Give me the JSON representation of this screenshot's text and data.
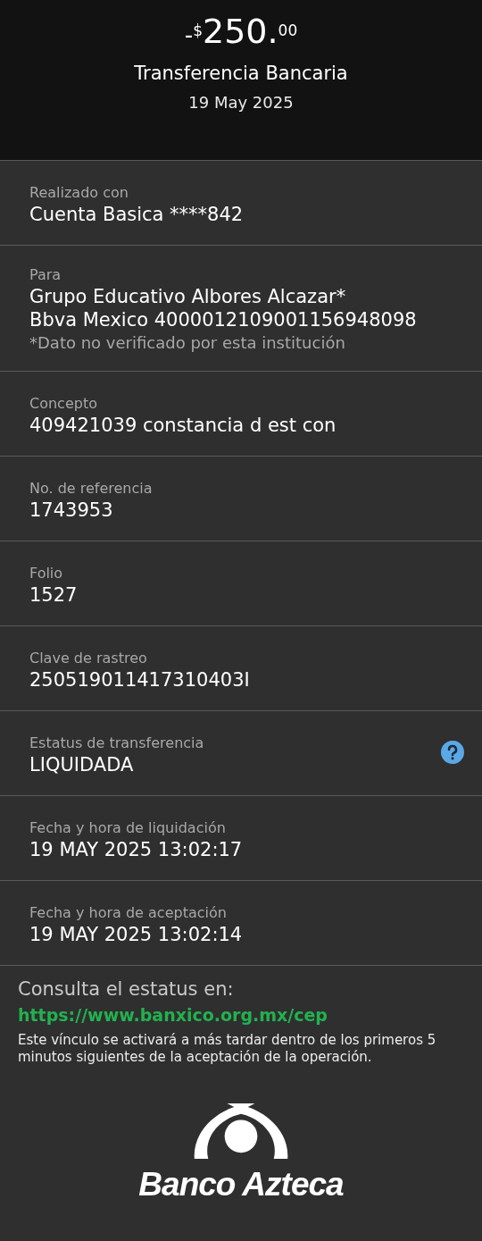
{
  "header": {
    "amount": {
      "sign": "-",
      "currency": "$",
      "whole": "250.",
      "cents": "00"
    },
    "title": "Transferencia Bancaria",
    "date": "19 May 2025"
  },
  "rows": [
    {
      "label": "Realizado con",
      "values": [
        "Cuenta Basica ****842"
      ],
      "help": false
    },
    {
      "label": "Para",
      "values": [
        "Grupo Educativo Albores Alcazar*",
        "Bbva Mexico 4000012109001156948098"
      ],
      "note": "*Dato no verificado por esta institución",
      "help": false
    },
    {
      "label": "Concepto",
      "values": [
        "409421039 constancia d est con"
      ],
      "help": false
    },
    {
      "label": "No. de referencia",
      "values": [
        "1743953"
      ],
      "help": false
    },
    {
      "label": "Folio",
      "values": [
        "1527"
      ],
      "help": false
    },
    {
      "label": "Clave de rastreo",
      "values": [
        "250519011417310403I"
      ],
      "help": false
    },
    {
      "label": "Estatus de transferencia",
      "values": [
        "LIQUIDADA"
      ],
      "help": true
    },
    {
      "label": "Fecha y hora de liquidación",
      "values": [
        "19 MAY 2025 13:02:17"
      ],
      "help": false
    },
    {
      "label": "Fecha y hora de aceptación",
      "values": [
        "19 MAY 2025 13:02:14"
      ],
      "help": false
    }
  ],
  "footer": {
    "heading": "Consulta el estatus en:",
    "link": "https://www.banxico.org.mx/cep",
    "note": "Este vínculo se activará a más tardar dentro de los primeros 5 minutos siguientes de la aceptación de la operación."
  },
  "brand": {
    "name": "Banco Azteca"
  }
}
